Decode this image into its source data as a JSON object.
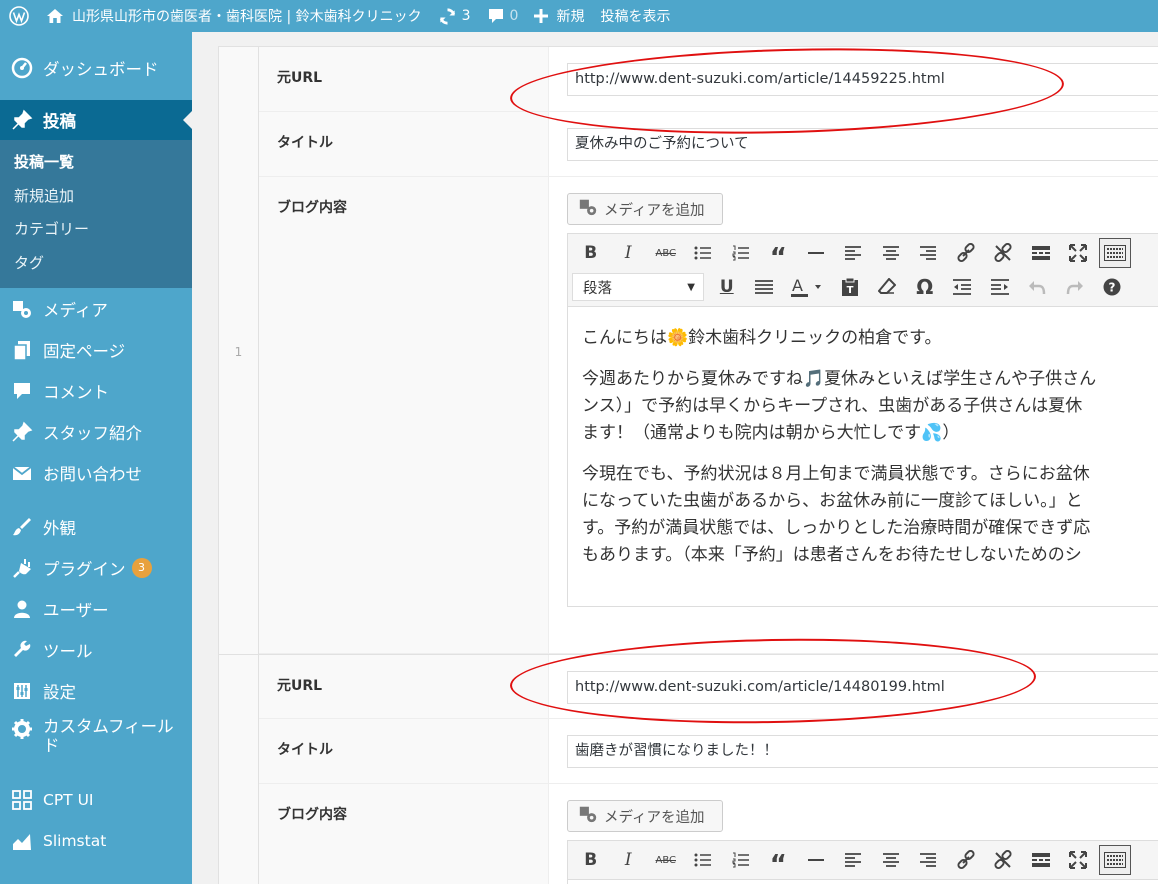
{
  "adminbar": {
    "site_name": "山形県山形市の歯医者・歯科医院 | 鈴木歯科クリニック",
    "updates_count": "3",
    "comments_count": "0",
    "new_label": "新規",
    "view_post_label": "投稿を表示"
  },
  "sidebar": {
    "dashboard": "ダッシュボード",
    "posts": "投稿",
    "posts_submenu": [
      "投稿一覧",
      "新規追加",
      "カテゴリー",
      "タグ"
    ],
    "media": "メディア",
    "pages": "固定ページ",
    "comments": "コメント",
    "staff": "スタッフ紹介",
    "contact": "お問い合わせ",
    "appearance": "外観",
    "plugins": "プラグイン",
    "plugins_badge": "3",
    "users": "ユーザー",
    "tools": "ツール",
    "settings": "設定",
    "custom_fields": "カスタムフィールド",
    "cpt_ui": "CPT UI",
    "slimstat": "Slimstat"
  },
  "rows": [
    {
      "number": "1",
      "url_label": "元URL",
      "url_value": "http://www.dent-suzuki.com/article/14459225.html",
      "title_label": "タイトル",
      "title_value": "夏休み中のご予約について",
      "content_label": "ブログ内容",
      "media_button": "メディアを追加",
      "format_select": "段落",
      "paragraphs": [
        "こんにちは🌼鈴木歯科クリニックの柏倉です。",
        "今週あたりから夏休みですね🎵夏休みといえば学生さんや子供さん",
        "ンス）」で予約は早くからキープされ、虫歯がある子供さんは夏休",
        "ます！（通常よりも院内は朝から大忙しです💦）",
        "今現在でも、予約状況は８月上旬まで満員状態です。さらにお盆休",
        "になっていた虫歯があるから、お盆休み前に一度診てほしい。」と",
        "す。予約が満員状態では、しっかりとした治療時間が確保できず応",
        "もあります。（本来「予約」は患者さんをお待たせしないためのシ"
      ]
    },
    {
      "url_label": "元URL",
      "url_value": "http://www.dent-suzuki.com/article/14480199.html",
      "title_label": "タイトル",
      "title_value": "歯磨きが習慣になりました！！",
      "content_label": "ブログ内容",
      "media_button": "メディアを追加"
    }
  ],
  "colors": {
    "admin_blue": "#4ea6cb",
    "menu_current": "#0b6a93",
    "submenu_bg": "#35789a",
    "annotation_red": "#e01010"
  }
}
